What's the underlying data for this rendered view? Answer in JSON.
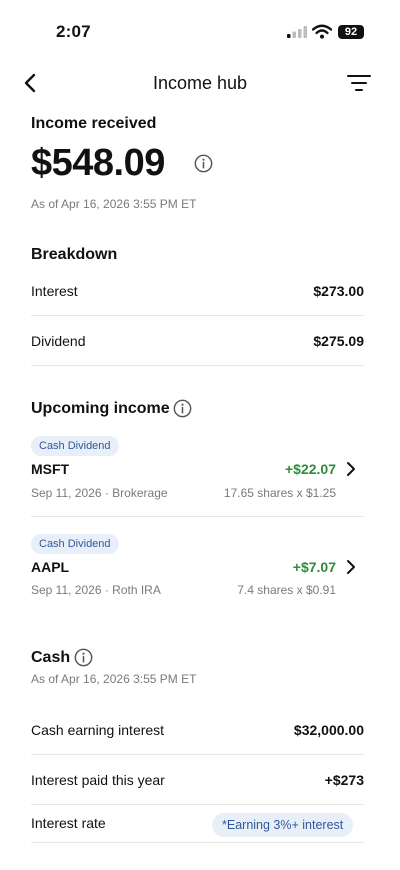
{
  "status": {
    "time": "2:07",
    "battery": "92"
  },
  "nav": {
    "title": "Income hub"
  },
  "income": {
    "heading": "Income received",
    "amount": "$548.09",
    "as_of": "As of Apr 16, 2026 3:55 PM ET"
  },
  "breakdown": {
    "heading": "Breakdown",
    "rows": [
      {
        "label": "Interest",
        "value": "$273.00"
      },
      {
        "label": "Dividend",
        "value": "$275.09"
      }
    ]
  },
  "upcoming": {
    "heading": "Upcoming income",
    "items": [
      {
        "badge": "Cash Dividend",
        "ticker": "MSFT",
        "amount": "+$22.07",
        "date_account": "Sep 11, 2026 · Brokerage",
        "shares": "17.65 shares x $1.25"
      },
      {
        "badge": "Cash Dividend",
        "ticker": "AAPL",
        "amount": "+$7.07",
        "date_account": "Sep 11, 2026 · Roth IRA",
        "shares": "7.4 shares x $0.91"
      }
    ]
  },
  "cash": {
    "heading": "Cash",
    "as_of": "As of Apr 16, 2026 3:55 PM ET",
    "rows": [
      {
        "label": "Cash earning interest",
        "value": "$32,000.00"
      },
      {
        "label": "Interest paid this year",
        "value": "+$273"
      },
      {
        "label": "Interest rate",
        "value": "*Earning 3%+ interest"
      }
    ]
  },
  "colors": {
    "gain": "#2f8b3b",
    "badge_bg": "#e9eff8",
    "badge_text": "#2f5a9a"
  },
  "icons": [
    "back-chevron-icon",
    "filter-icon",
    "info-icon",
    "chevron-right-icon",
    "signal-icon",
    "wifi-icon",
    "battery-icon"
  ]
}
